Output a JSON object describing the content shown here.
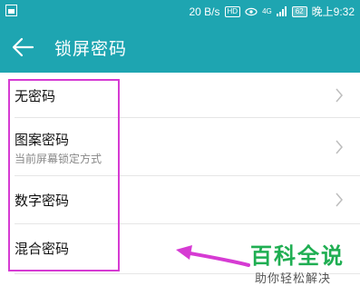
{
  "status_bar": {
    "speed": "20 B/s",
    "hd_badge": "HD",
    "signal_label": "4G",
    "battery": "62",
    "time": "晚上9:32",
    "icons": [
      "screenshot-icon",
      "eye-icon",
      "signal-icon",
      "battery-icon"
    ]
  },
  "header": {
    "title": "锁屏密码",
    "back_icon": "back-arrow-icon"
  },
  "options": [
    {
      "label": "无密码"
    },
    {
      "label": "图案密码",
      "subtitle": "当前屏幕锁定方式"
    },
    {
      "label": "数字密码"
    },
    {
      "label": "混合密码"
    }
  ],
  "watermark": {
    "title": "百科全说",
    "subtitle": "助你轻松解决"
  },
  "colors": {
    "accent": "#1ea5b1",
    "highlight": "#d63bd3",
    "watermark_green": "#1fae52"
  }
}
